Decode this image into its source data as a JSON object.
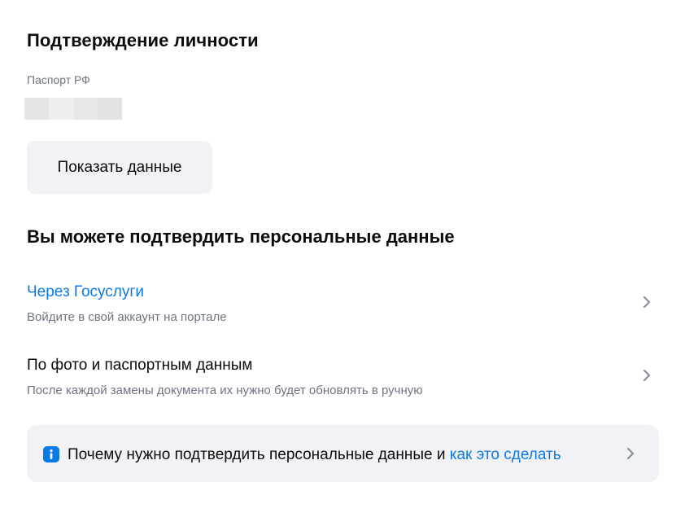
{
  "identity": {
    "title": "Подтверждение личности",
    "document_label": "Паспорт РФ",
    "show_button_label": "Показать данные"
  },
  "confirm": {
    "title": "Вы можете подтвердить персональные данные",
    "options": [
      {
        "title": "Через Госуслуги",
        "description": "Войдите в свой аккаунт на портале",
        "icon": "chevron-right-icon"
      },
      {
        "title": "По фото и паспортным данным",
        "description": "После каждой замены документа их нужно будет обновлять в ручную",
        "icon": "chevron-right-icon"
      }
    ]
  },
  "info": {
    "text": "Почему нужно подтвердить персональные данные и ",
    "link_text": "как это сделать",
    "icon": "info-icon"
  },
  "colors": {
    "accent": "#0a7ae6",
    "muted_text": "#6e7482",
    "surface": "#f1f2f6",
    "chevron": "#8a90a0"
  }
}
